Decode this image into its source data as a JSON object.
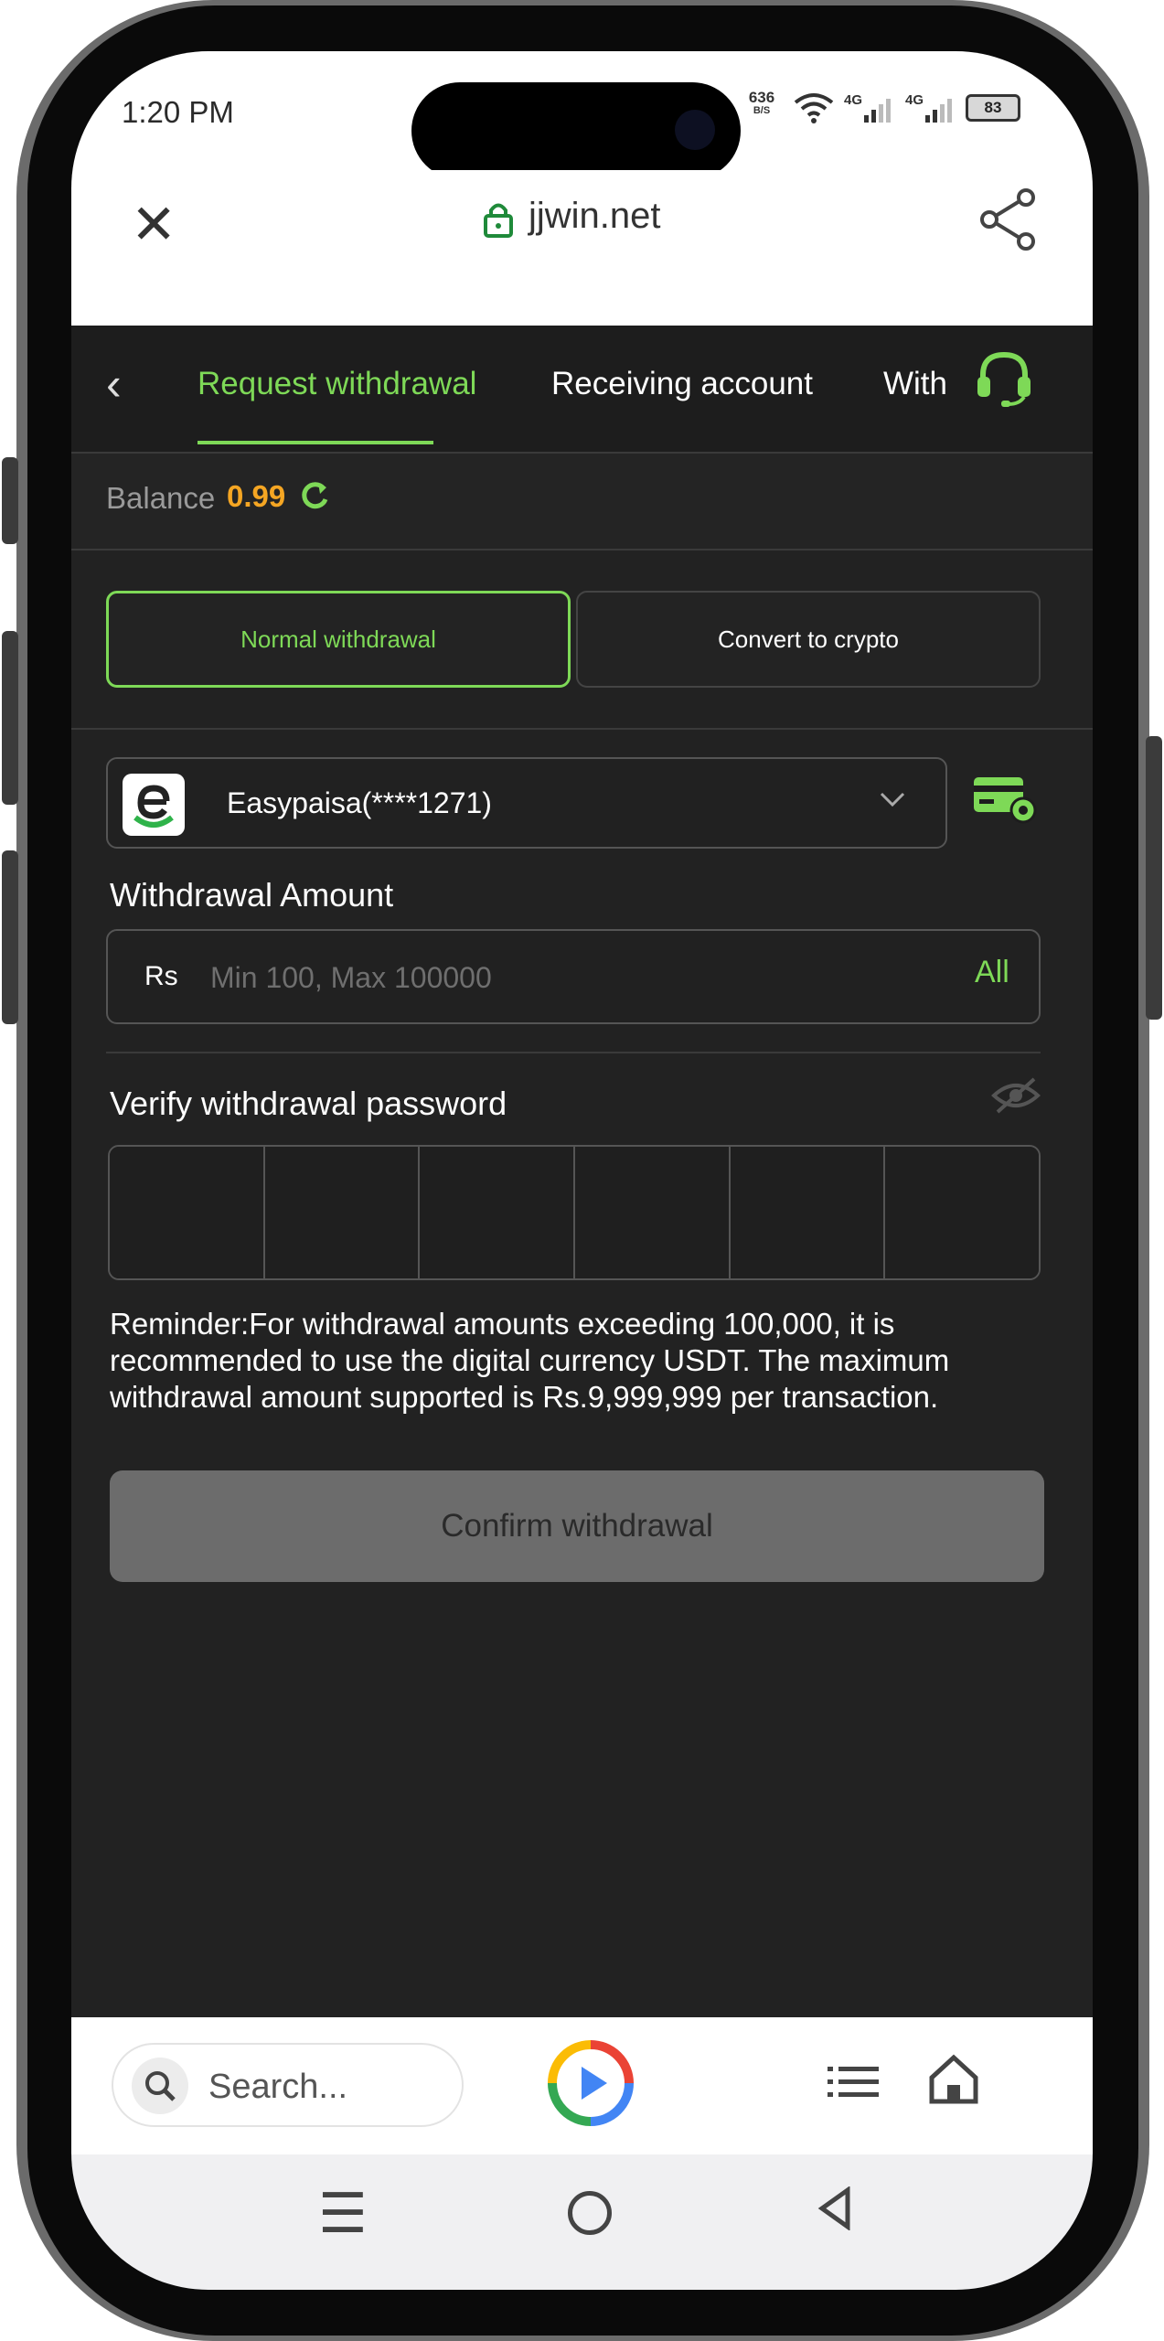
{
  "status": {
    "time": "1:20 PM",
    "net_speed": "636",
    "net_unit": "B/S",
    "sig1": "4G",
    "sig2": "4G",
    "battery": "83"
  },
  "browser": {
    "domain": "jjwin.net",
    "search_placeholder": "Search..."
  },
  "tabs": [
    {
      "label": "Request withdrawal"
    },
    {
      "label": "Receiving account"
    },
    {
      "label": "With"
    }
  ],
  "balance": {
    "label": "Balance",
    "value": "0.99"
  },
  "mode": {
    "normal": "Normal withdrawal",
    "crypto": "Convert to crypto"
  },
  "account": {
    "selected": "Easypaisa(****1271)"
  },
  "amount": {
    "label": "Withdrawal Amount",
    "currency": "Rs",
    "placeholder": "Min 100, Max 100000",
    "all": "All"
  },
  "password": {
    "label": "Verify withdrawal password"
  },
  "reminder": "Reminder:For withdrawal amounts exceeding 100,000, it is recommended to use the digital currency USDT. The maximum withdrawal amount supported is Rs.9,999,999 per transaction.",
  "confirm_label": "Confirm withdrawal",
  "colors": {
    "accent": "#7ed957",
    "balance": "#f5a623",
    "background": "#222222"
  }
}
